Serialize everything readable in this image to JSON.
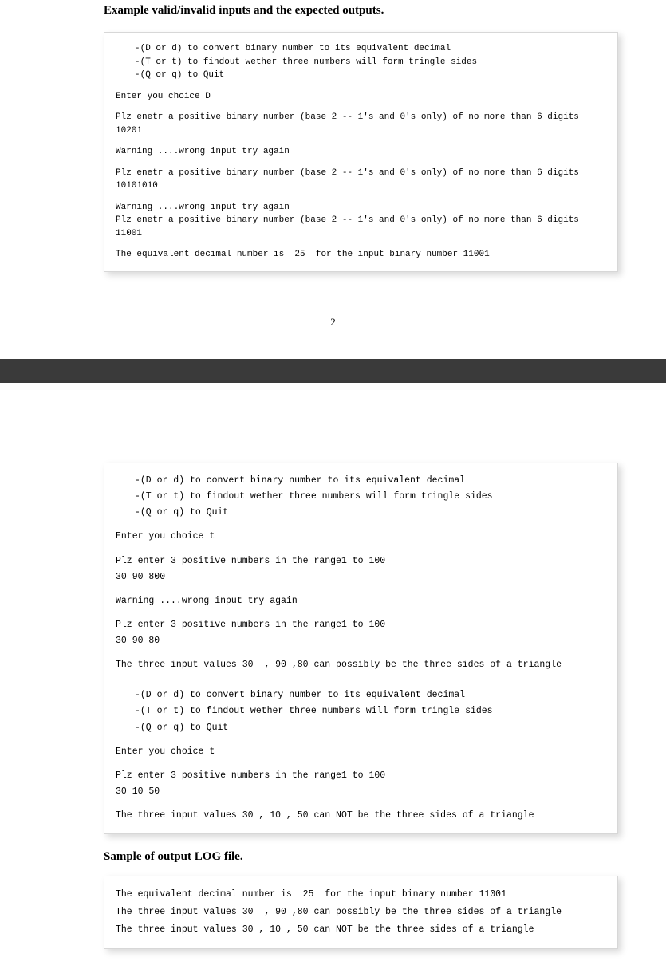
{
  "page1": {
    "heading": "Example valid/invalid inputs and the expected outputs.",
    "box1": {
      "menu1": "-(D or d) to convert binary number to its equivalent decimal",
      "menu2": "-(T or t) to findout wether three numbers will form tringle sides",
      "menu3": "-(Q or q) to Quit",
      "l1": "Enter you choice D",
      "l2": "Plz enetr a positive binary number (base 2 -- 1's and 0's only) of no more than 6 digits",
      "l3": "10201",
      "l4": "Warning ....wrong input try again",
      "l5": "Plz enetr a positive binary number (base 2 -- 1's and 0's only) of no more than 6 digits",
      "l6": "10101010",
      "l7": "Warning ....wrong input try again",
      "l8": "Plz enetr a positive binary number (base 2 -- 1's and 0's only) of no more than 6 digits",
      "l9": "11001",
      "l10": "The equivalent decimal number is  25  for the input binary number 11001"
    },
    "pagenum": "2"
  },
  "page2": {
    "box2": {
      "menuA1": "-(D or d) to convert binary number to its equivalent decimal",
      "menuA2": "-(T or t) to findout wether three numbers will form tringle sides",
      "menuA3": "-(Q or q) to Quit",
      "a1": "Enter you choice t",
      "a2": "Plz enter 3 positive numbers in the range1 to 100",
      "a3": "30 90 800",
      "a4": "Warning ....wrong input try again",
      "a5": "Plz enter 3 positive numbers in the range1 to 100",
      "a6": "30 90 80",
      "a7": "The three input values 30  , 90 ,80 can possibly be the three sides of a triangle",
      "menuB1": "-(D or d) to convert binary number to its equivalent decimal",
      "menuB2": "-(T or t) to findout wether three numbers will form tringle sides",
      "menuB3": "-(Q or q) to Quit",
      "b1": "Enter you choice t",
      "b2": "Plz enter 3 positive numbers in the range1 to 100",
      "b3": "30 10 50",
      "b4": "The three input values 30 , 10 , 50 can NOT be the three sides of a triangle"
    },
    "subheading": "Sample of output LOG file.",
    "box3": {
      "c1": "The equivalent decimal number is  25  for the input binary number 11001",
      "c2": "The three input values 30  , 90 ,80 can possibly be the three sides of a triangle",
      "c3": "The three input values 30 , 10 , 50 can NOT be the three sides of a triangle"
    }
  }
}
